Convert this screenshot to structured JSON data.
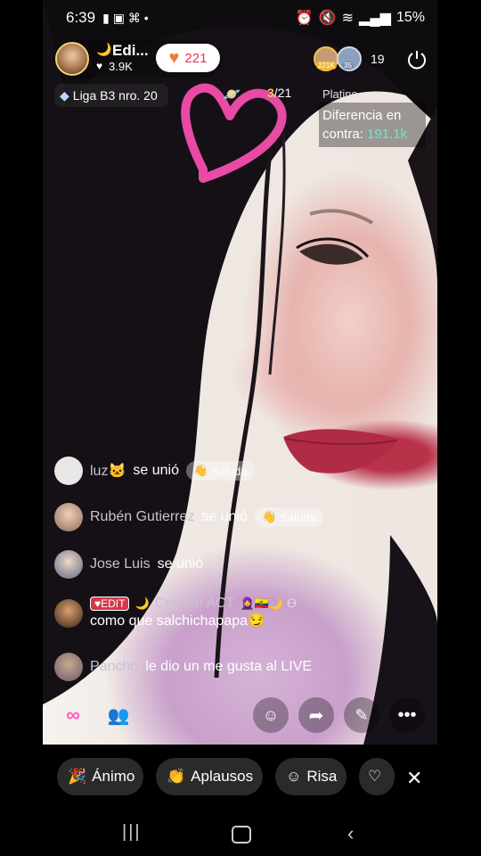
{
  "status_bar": {
    "time": "6:39",
    "battery": "15%"
  },
  "host": {
    "name": "Edi...",
    "followers": "3.9K",
    "likes": "221"
  },
  "league": {
    "label": "Liga B3 nro. 20"
  },
  "rank": {
    "current": "3",
    "total": "/21"
  },
  "battle": {
    "tier": "Platino",
    "diff_label": "Diferencia en",
    "diff_prefix": "contra:",
    "diff_value": "191.1k"
  },
  "viewers": {
    "a": "221K",
    "b": "35",
    "count": "19"
  },
  "chat": [
    {
      "user": "luz🐱",
      "text": "se unió",
      "chip": "Saluda"
    },
    {
      "user": "Rubén Gutierrez",
      "text": "se unió",
      "chip": "Saluda"
    },
    {
      "user": "Jose Luis",
      "text": "se unió"
    },
    {
      "badge": "EDIT",
      "user": "Cristian ACT",
      "message": "como que salchichapapa😏"
    },
    {
      "user": "Pancho",
      "text": "le dio un me gusta al LIVE"
    }
  ],
  "quick_actions": [
    "Ánimo",
    "Aplausos",
    "Risa"
  ]
}
